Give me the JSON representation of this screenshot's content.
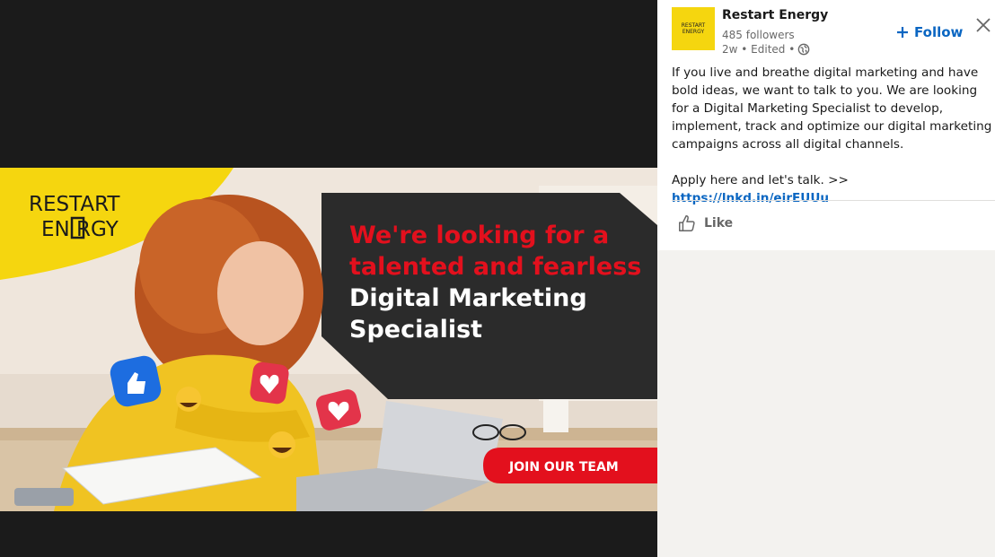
{
  "banner": {
    "brand_line1": "RESTART",
    "brand_line2": "EN  RGY",
    "headline_red_1": "We're looking for a",
    "headline_red_2": "talented and fearless",
    "headline_white_1": "Digital Marketing",
    "headline_white_2": "Specialist",
    "cta_label": "JOIN OUR TEAM",
    "colors": {
      "brand_yellow": "#f5d60f",
      "cta_red": "#e3101d",
      "dark_panel": "#2b2b2b"
    }
  },
  "post": {
    "company_name": "Restart Energy",
    "logo_line1": "RESTART",
    "logo_line2": "ENERGY",
    "followers": "485 followers",
    "meta": "2w • Edited •",
    "follow_label": "Follow",
    "body_paragraph": "If you live and breathe digital marketing and have bold ideas, we want to talk to you. We are looking for a Digital Marketing Specialist to develop, implement, track and optimize our digital marketing campaigns across all digital channels.",
    "apply_text": "Apply here and let's talk. >> ",
    "apply_link": "https://lnkd.in/eirEUUu",
    "like_label": "Like",
    "icons": {
      "follow": "plus-icon",
      "close": "close-icon",
      "visibility": "globe-icon",
      "like": "thumbs-up-icon"
    },
    "colors": {
      "link_blue": "#0a66c2"
    }
  }
}
